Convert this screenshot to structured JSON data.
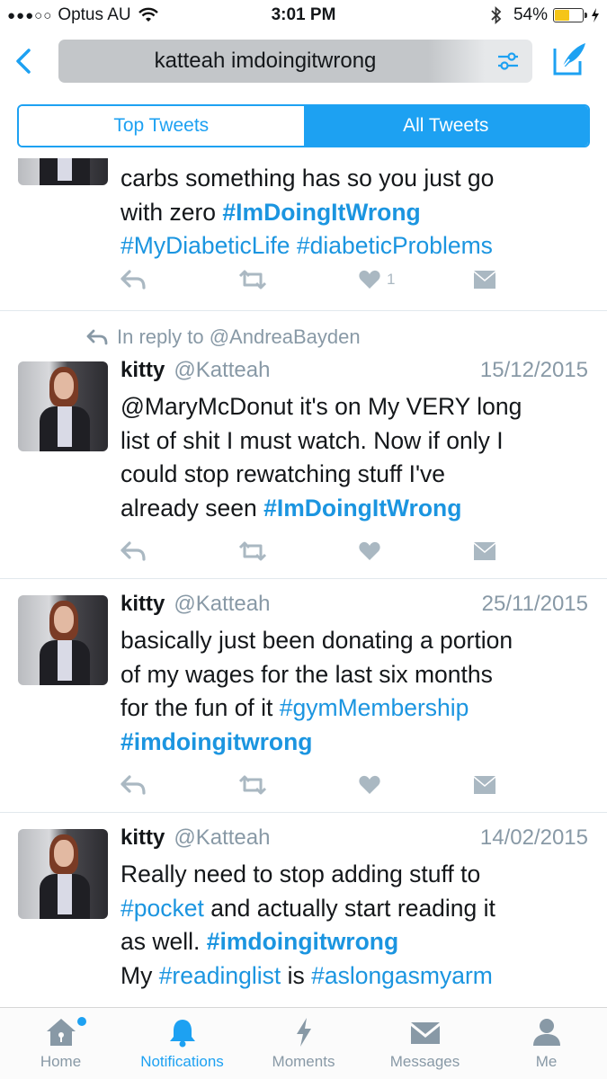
{
  "status_bar": {
    "carrier": "Optus AU",
    "time": "3:01 PM",
    "battery_pct": "54%",
    "battery_level": 0.54
  },
  "search": {
    "query": "katteah imdoingitwrong"
  },
  "segments": {
    "top": "Top Tweets",
    "all": "All Tweets",
    "selected": "all"
  },
  "tweets": [
    {
      "text_parts": [
        {
          "t": "carbs something has so you just go\nwith zero ",
          "tag": false
        },
        {
          "t": "#ImDoingItWrong",
          "tag": true,
          "bold": true
        },
        {
          "t": "\n",
          "tag": false
        },
        {
          "t": "#MyDiabeticLife",
          "tag": true
        },
        {
          "t": " ",
          "tag": false
        },
        {
          "t": "#diabeticProblems",
          "tag": true
        }
      ],
      "like_count": "1"
    },
    {
      "reply_context": "In reply to @AndreaBayden",
      "name": "kitty",
      "handle": "@Katteah",
      "date": "15/12/2015",
      "text_parts": [
        {
          "t": "@MaryMcDonut it's on My VERY long\nlist of shit I must watch. Now if only I\ncould stop rewatching stuff I've\nalready seen ",
          "tag": false
        },
        {
          "t": "#ImDoingItWrong",
          "tag": true,
          "bold": true
        }
      ]
    },
    {
      "name": "kitty",
      "handle": "@Katteah",
      "date": "25/11/2015",
      "text_parts": [
        {
          "t": "basically just been donating a portion\nof my wages for the last six months\nfor the fun of it ",
          "tag": false
        },
        {
          "t": "#gymMembership",
          "tag": true
        },
        {
          "t": "\n",
          "tag": false
        },
        {
          "t": "#imdoingitwrong",
          "tag": true,
          "bold": true
        }
      ]
    },
    {
      "name": "kitty",
      "handle": "@Katteah",
      "date": "14/02/2015",
      "text_parts": [
        {
          "t": "Really need to stop adding stuff to\n",
          "tag": false
        },
        {
          "t": "#pocket",
          "tag": true
        },
        {
          "t": " and actually start reading it\nas well. ",
          "tag": false
        },
        {
          "t": "#imdoingitwrong",
          "tag": true,
          "bold": true
        },
        {
          "t": "\nMy ",
          "tag": false
        },
        {
          "t": "#readinglist",
          "tag": true
        },
        {
          "t": " is ",
          "tag": false
        },
        {
          "t": "#aslongasmyarm",
          "tag": true
        }
      ]
    }
  ],
  "tab_bar": [
    {
      "label": "Home",
      "icon": "home-icon",
      "badge": true
    },
    {
      "label": "Notifications",
      "icon": "bell-icon",
      "active": true
    },
    {
      "label": "Moments",
      "icon": "lightning-icon"
    },
    {
      "label": "Messages",
      "icon": "envelope-icon"
    },
    {
      "label": "Me",
      "icon": "person-icon"
    }
  ],
  "colors": {
    "accent": "#1da1f2",
    "hashtag": "#1b95e0",
    "muted": "#8899a6",
    "action_icon": "#aab8c2"
  }
}
